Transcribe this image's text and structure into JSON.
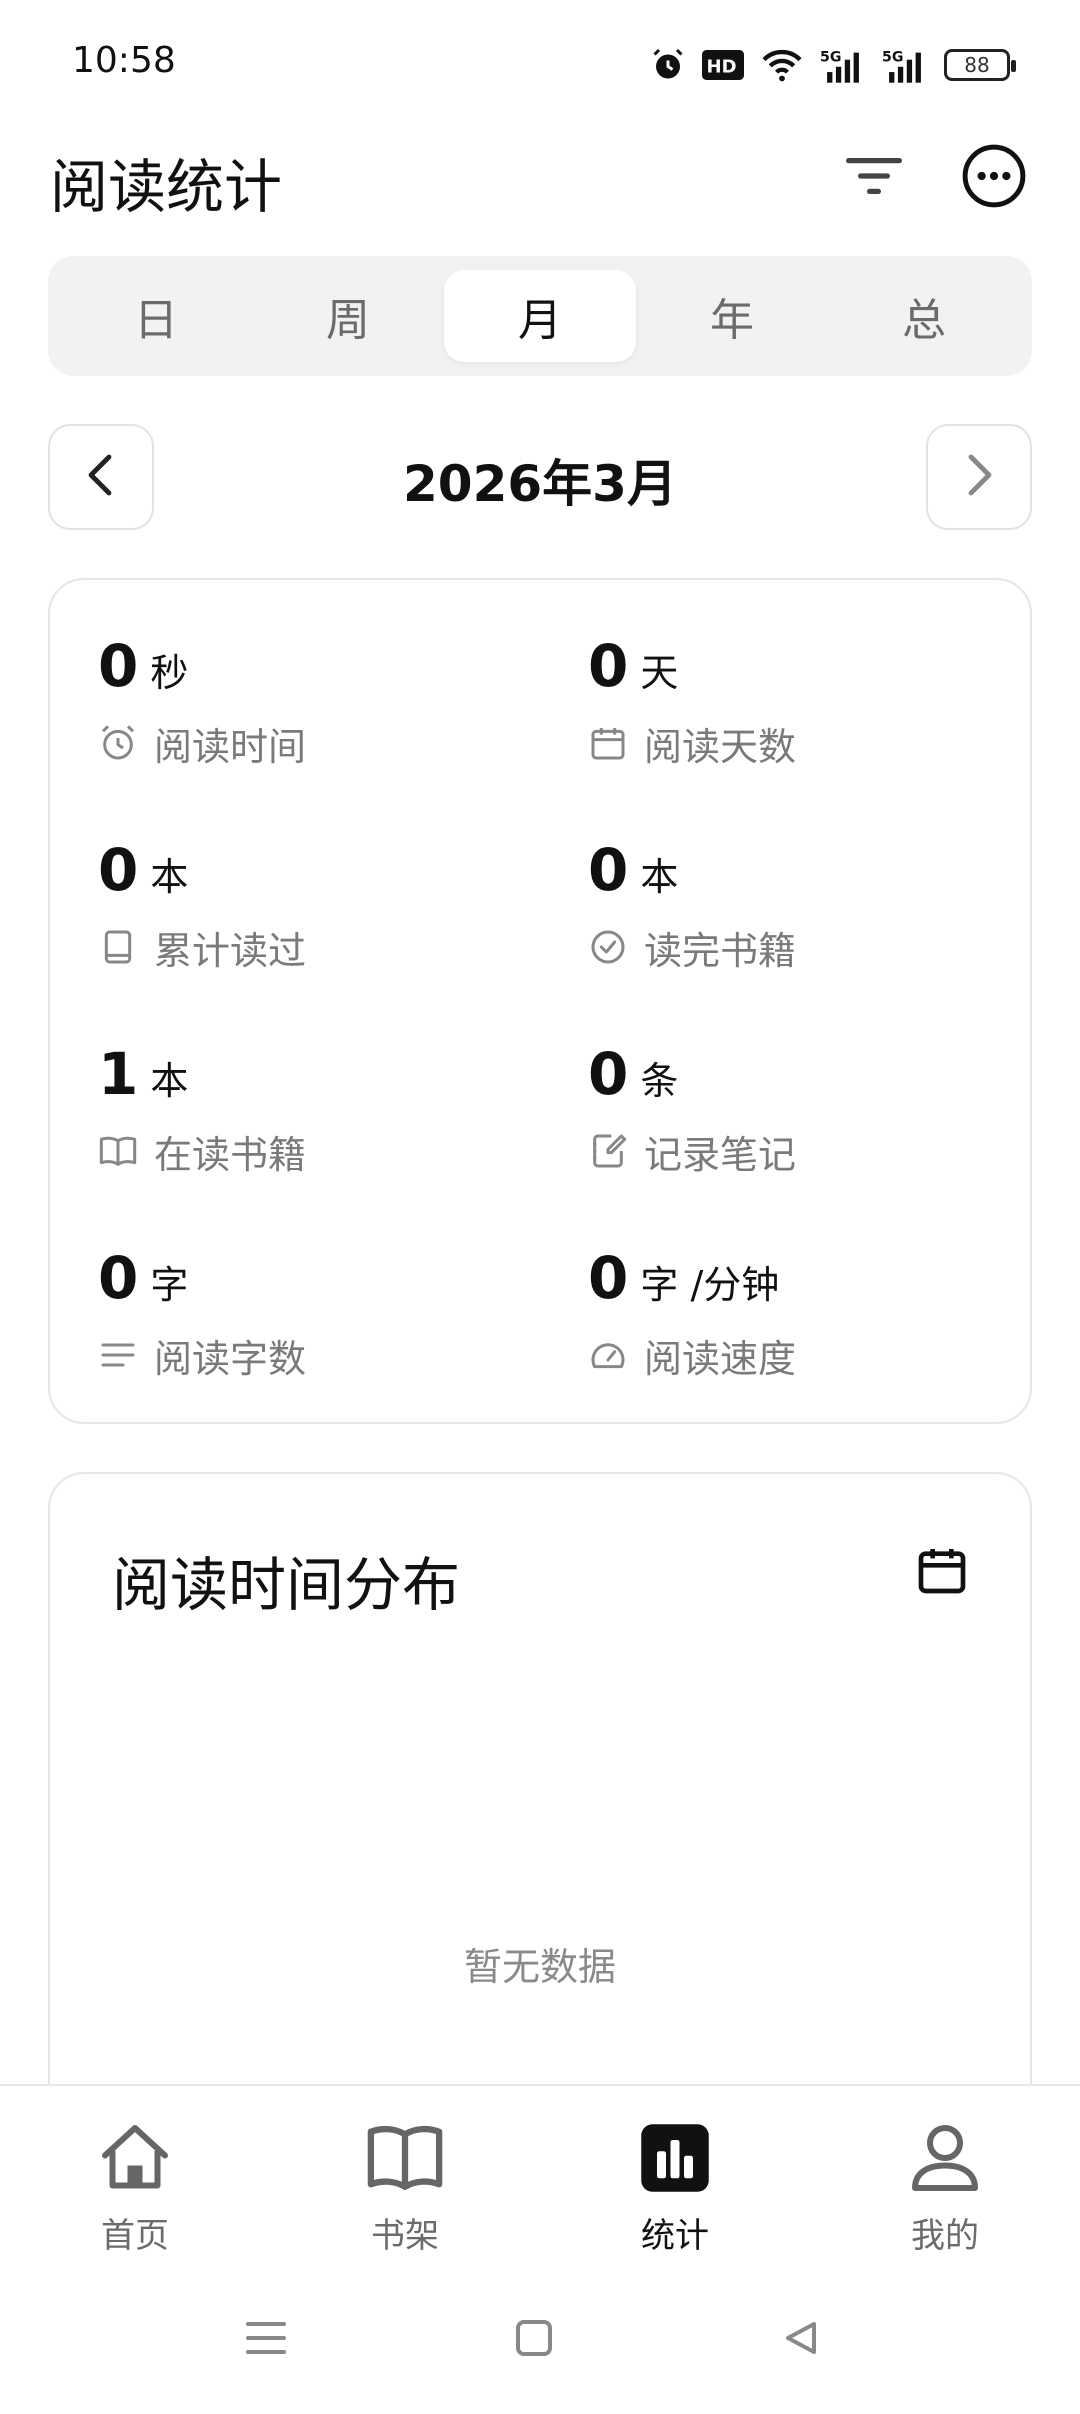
{
  "status_bar": {
    "time": "10:58",
    "battery": "88",
    "icons": [
      "alarm-icon",
      "hd-icon",
      "wifi-icon",
      "5g-signal-icon",
      "5g-signal-icon"
    ]
  },
  "header": {
    "title": "阅读统计",
    "icons": [
      "filter-icon",
      "more-icon"
    ]
  },
  "tabs": [
    {
      "label": "日",
      "active": false
    },
    {
      "label": "周",
      "active": false
    },
    {
      "label": "月",
      "active": true
    },
    {
      "label": "年",
      "active": false
    },
    {
      "label": "总",
      "active": false
    }
  ],
  "period": {
    "label": "2026年3月"
  },
  "stats": [
    {
      "value": "0",
      "unit": "秒",
      "label": "阅读时间",
      "icon": "alarm-clock-icon"
    },
    {
      "value": "0",
      "unit": "天",
      "label": "阅读天数",
      "icon": "calendar-icon"
    },
    {
      "value": "0",
      "unit": "本",
      "label": "累计读过",
      "icon": "book-icon"
    },
    {
      "value": "0",
      "unit": "本",
      "label": "读完书籍",
      "icon": "check-circle-icon"
    },
    {
      "value": "1",
      "unit": "本",
      "label": "在读书籍",
      "icon": "open-book-icon"
    },
    {
      "value": "0",
      "unit": "条",
      "label": "记录笔记",
      "icon": "notebook-edit-icon"
    },
    {
      "value": "0",
      "unit": "字",
      "label": "阅读字数",
      "icon": "text-lines-icon"
    },
    {
      "value": "0",
      "unit": "字 /分钟",
      "label": "阅读速度",
      "icon": "speedometer-icon"
    }
  ],
  "distribution": {
    "title": "阅读时间分布",
    "empty_text": "暂无数据"
  },
  "bottom_nav": [
    {
      "label": "首页",
      "icon": "home-icon",
      "active": false
    },
    {
      "label": "书架",
      "icon": "bookshelf-icon",
      "active": false
    },
    {
      "label": "统计",
      "icon": "stats-icon",
      "active": true
    },
    {
      "label": "我的",
      "icon": "profile-icon",
      "active": false
    }
  ]
}
